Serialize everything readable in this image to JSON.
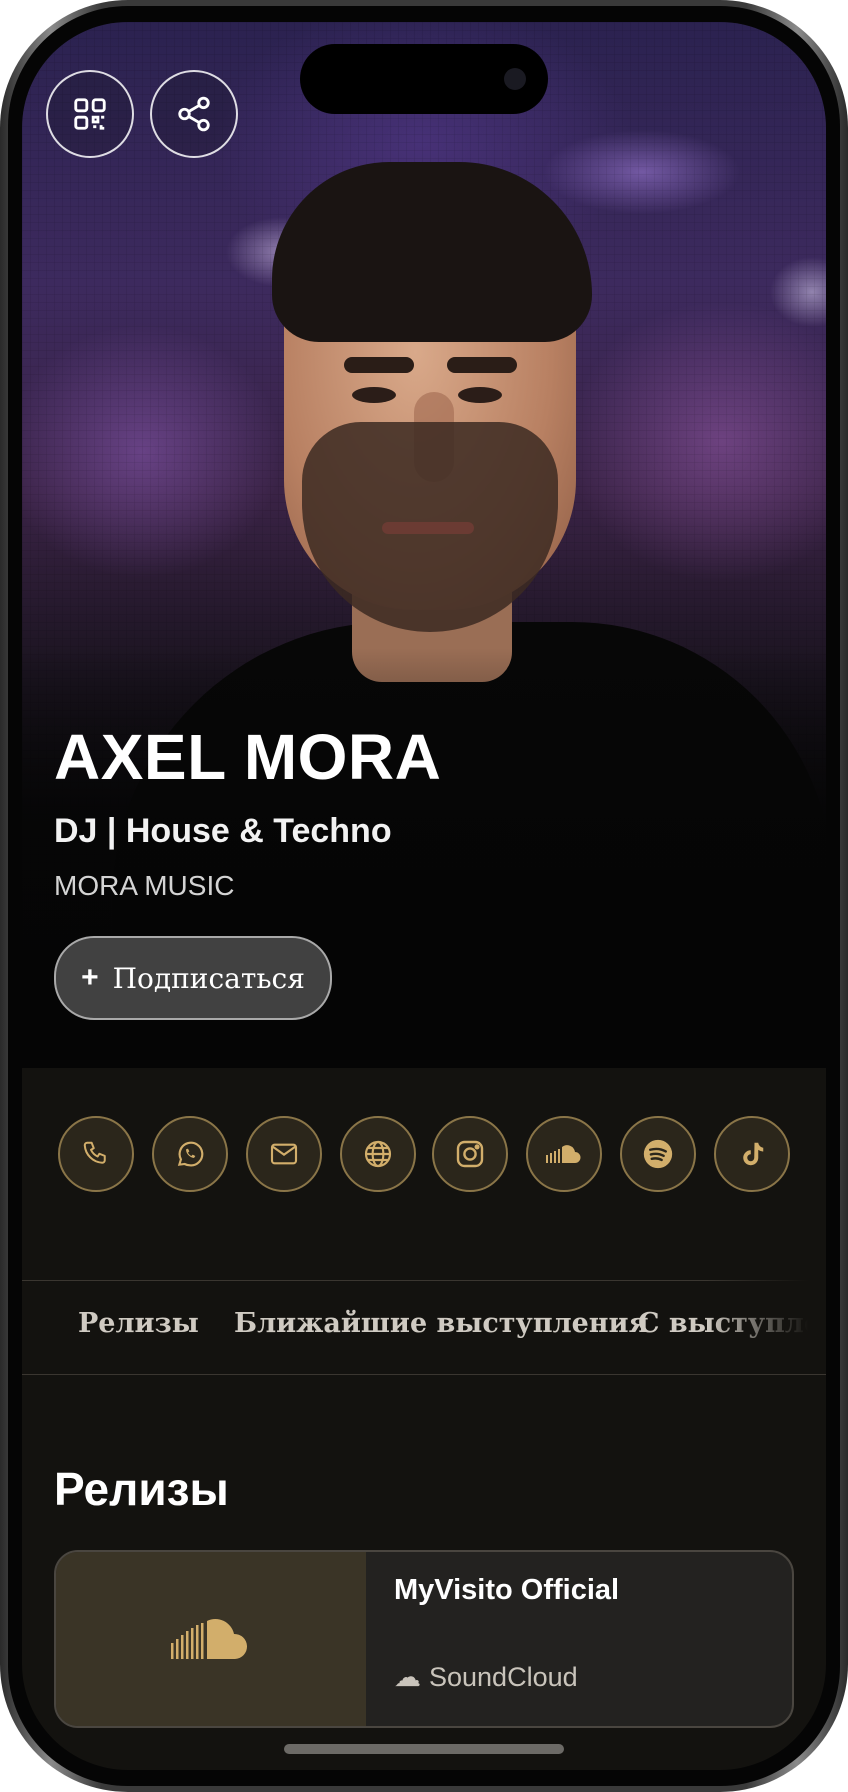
{
  "profile": {
    "name": "AXEL MORA",
    "role": "DJ | House & Techno",
    "label": "MORA MUSIC",
    "follow_label": "Подписаться",
    "follow_icon": "+"
  },
  "top_actions": {
    "qr_icon": "qr-code-icon",
    "share_icon": "share-icon"
  },
  "contacts": [
    {
      "icon": "phone-icon"
    },
    {
      "icon": "whatsapp-icon"
    },
    {
      "icon": "mail-icon"
    },
    {
      "icon": "globe-icon"
    },
    {
      "icon": "instagram-icon"
    },
    {
      "icon": "soundcloud-icon"
    },
    {
      "icon": "spotify-icon"
    },
    {
      "icon": "tiktok-icon"
    }
  ],
  "tabs": [
    {
      "label": "Релизы"
    },
    {
      "label": "Ближайшие выступления"
    },
    {
      "label": "С выступлений"
    }
  ],
  "releases": {
    "section_title": "Релизы",
    "items": [
      {
        "title": "MyVisito Official",
        "source": "SoundCloud",
        "source_icon": "☁"
      }
    ]
  },
  "colors": {
    "accent_gold": "#d2ae6b",
    "background": "#13120f",
    "card_background": "#232220"
  }
}
